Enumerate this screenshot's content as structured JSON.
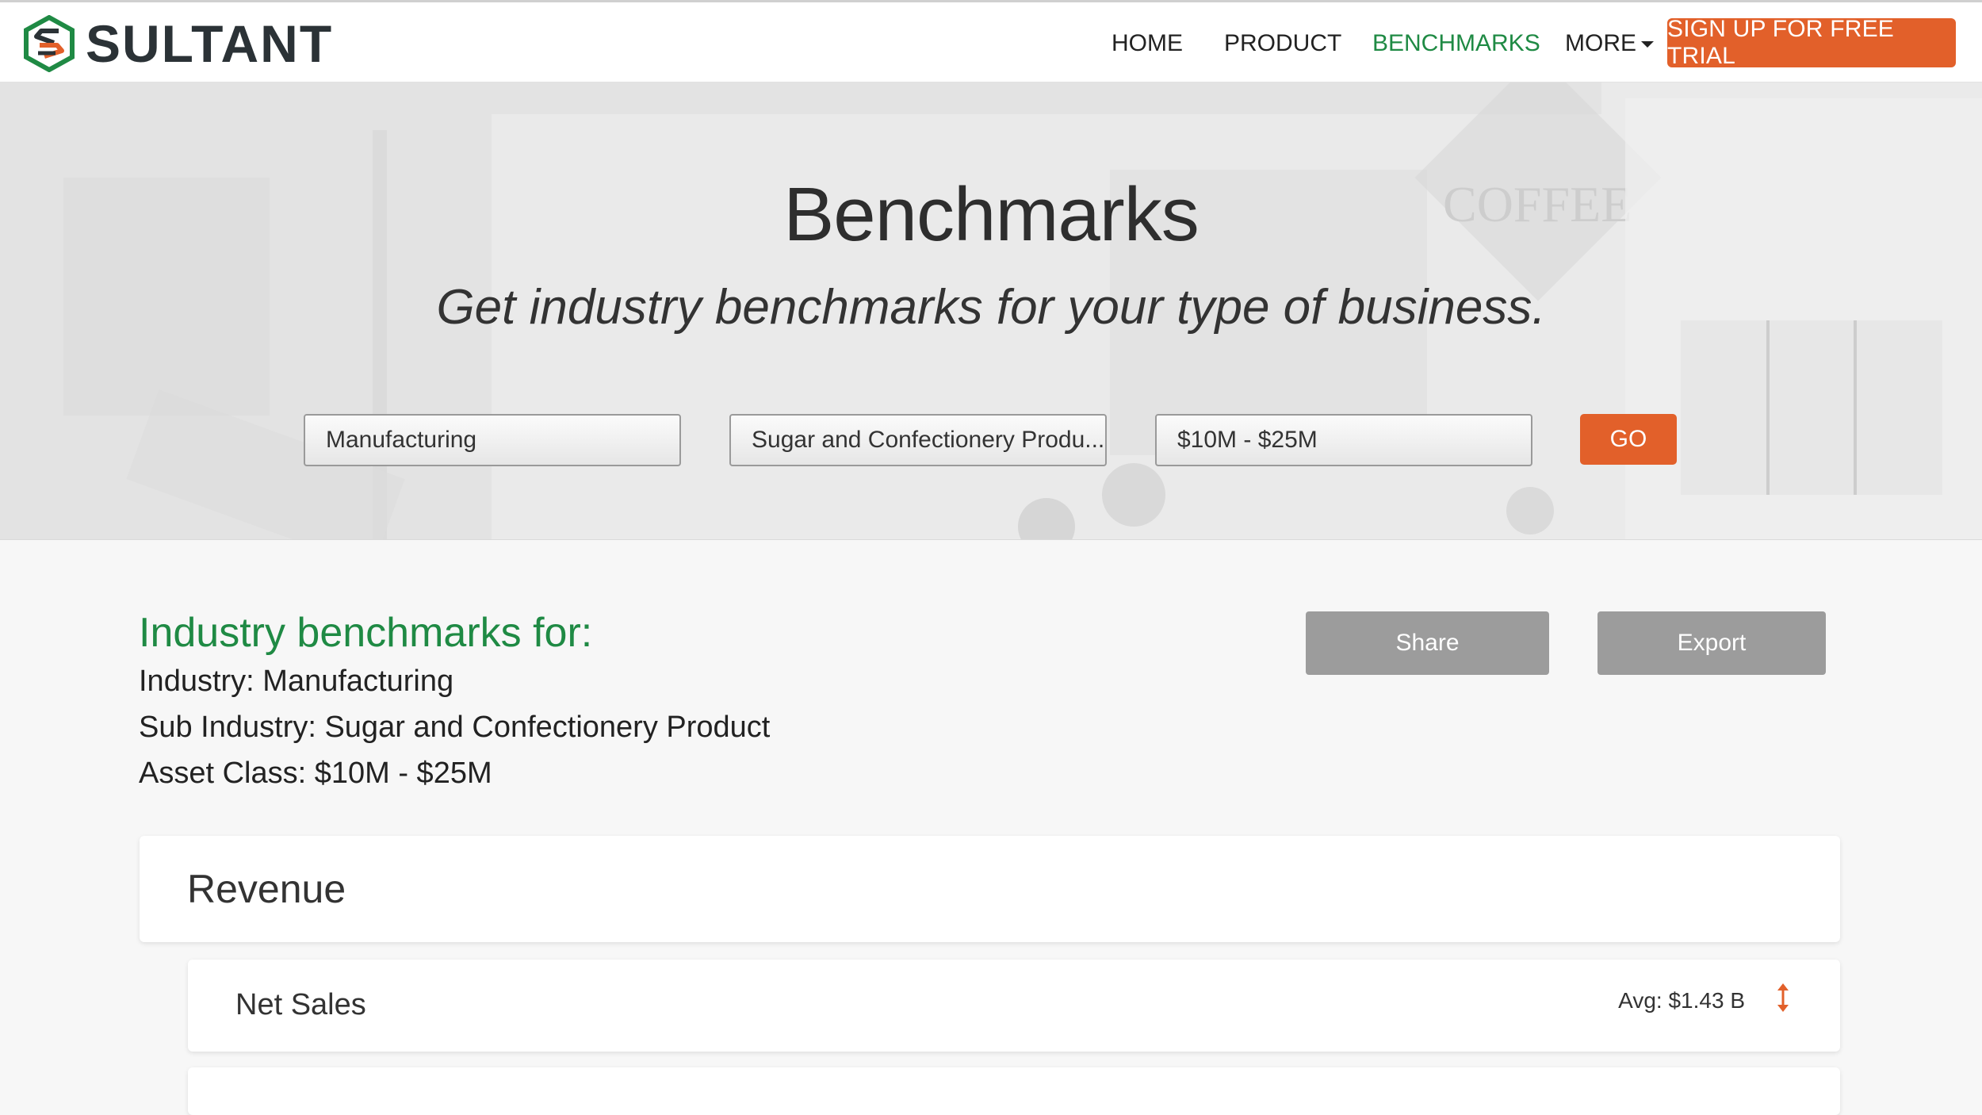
{
  "brand": {
    "name": "SULTANT",
    "colors": {
      "green": "#1f8a44",
      "orange": "#e2602a",
      "dark": "#2b3236"
    }
  },
  "nav": {
    "items": [
      {
        "label": "HOME"
      },
      {
        "label": "PRODUCT"
      },
      {
        "label": "BENCHMARKS",
        "active": true
      },
      {
        "label": "MORE"
      }
    ],
    "cta_label": "SIGN UP FOR FREE TRIAL"
  },
  "hero": {
    "title": "Benchmarks",
    "subtitle": "Get industry benchmarks for your type of business.",
    "filters": {
      "industry": "Manufacturing",
      "sub_industry": "Sugar and Confectionery Produ...",
      "asset_class": "$10M - $25M"
    },
    "go_label": "GO",
    "background_sign": "COFFEE"
  },
  "summary": {
    "title": "Industry benchmarks for:",
    "industry_line": "Industry: Manufacturing",
    "sub_industry_line": "Sub Industry: Sugar and Confectionery Product",
    "asset_class_line": "Asset Class: $10M - $25M",
    "share_label": "Share",
    "export_label": "Export"
  },
  "sections": [
    {
      "title": "Revenue",
      "rows": [
        {
          "label": "Net Sales",
          "avg": "Avg: $1.43 B",
          "icon": "sort-icon"
        }
      ]
    }
  ]
}
